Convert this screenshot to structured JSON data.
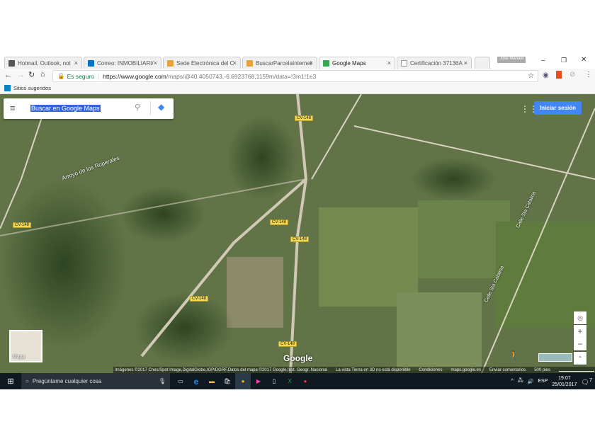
{
  "browser": {
    "tabs": [
      {
        "label": "Hotmail, Outlook, not",
        "icon": "outlook-icon",
        "color": "#555"
      },
      {
        "label": "Correo: INMOBILIARI/",
        "icon": "outlook-mail-icon",
        "color": "#0072c6"
      },
      {
        "label": "Sede Electrónica del C",
        "icon": "catastro-icon",
        "color": "#e8a23a"
      },
      {
        "label": "BuscarParcelaInternet",
        "icon": "catastro-icon",
        "color": "#e8a23a"
      },
      {
        "label": "Google Maps",
        "icon": "google-maps-icon",
        "color": "#34a853"
      },
      {
        "label": "Certificación 37136A",
        "icon": "document-icon",
        "color": "#999"
      }
    ],
    "user": "Jose Manuel",
    "secure_label": "Es seguro",
    "url_host": "https://www.google.com",
    "url_path": "/maps/@40.4050743,-6.6923768,1159m/data=!3m1!1e3",
    "bookmark": "Sitios sugeridos"
  },
  "maps": {
    "search_placeholder": "Buscar en Google Maps",
    "login": "Iniciar sesión",
    "road": "CV-148",
    "stream": "Arroyo de los Roperales",
    "street": "Calle Sta Catalina",
    "layer_label": "Mapa",
    "logo": "Google",
    "attribution": [
      "Imágenes ©2017 Cnes/Spot Image,DigitalGlobe,IGP/DGRF,Datos del mapa ©2017 Google,Inst. Geogr. Nacional",
      "La vista Tierra en 3D no está disponible",
      "Condiciones",
      "maps.google.es",
      "Enviar comentarios"
    ],
    "scale": "500 pies"
  },
  "taskbar": {
    "search": "Pregúntame cualquier cosa",
    "lang": "ESP",
    "time": "19:07",
    "date": "25/01/2017",
    "notifications": "7"
  }
}
